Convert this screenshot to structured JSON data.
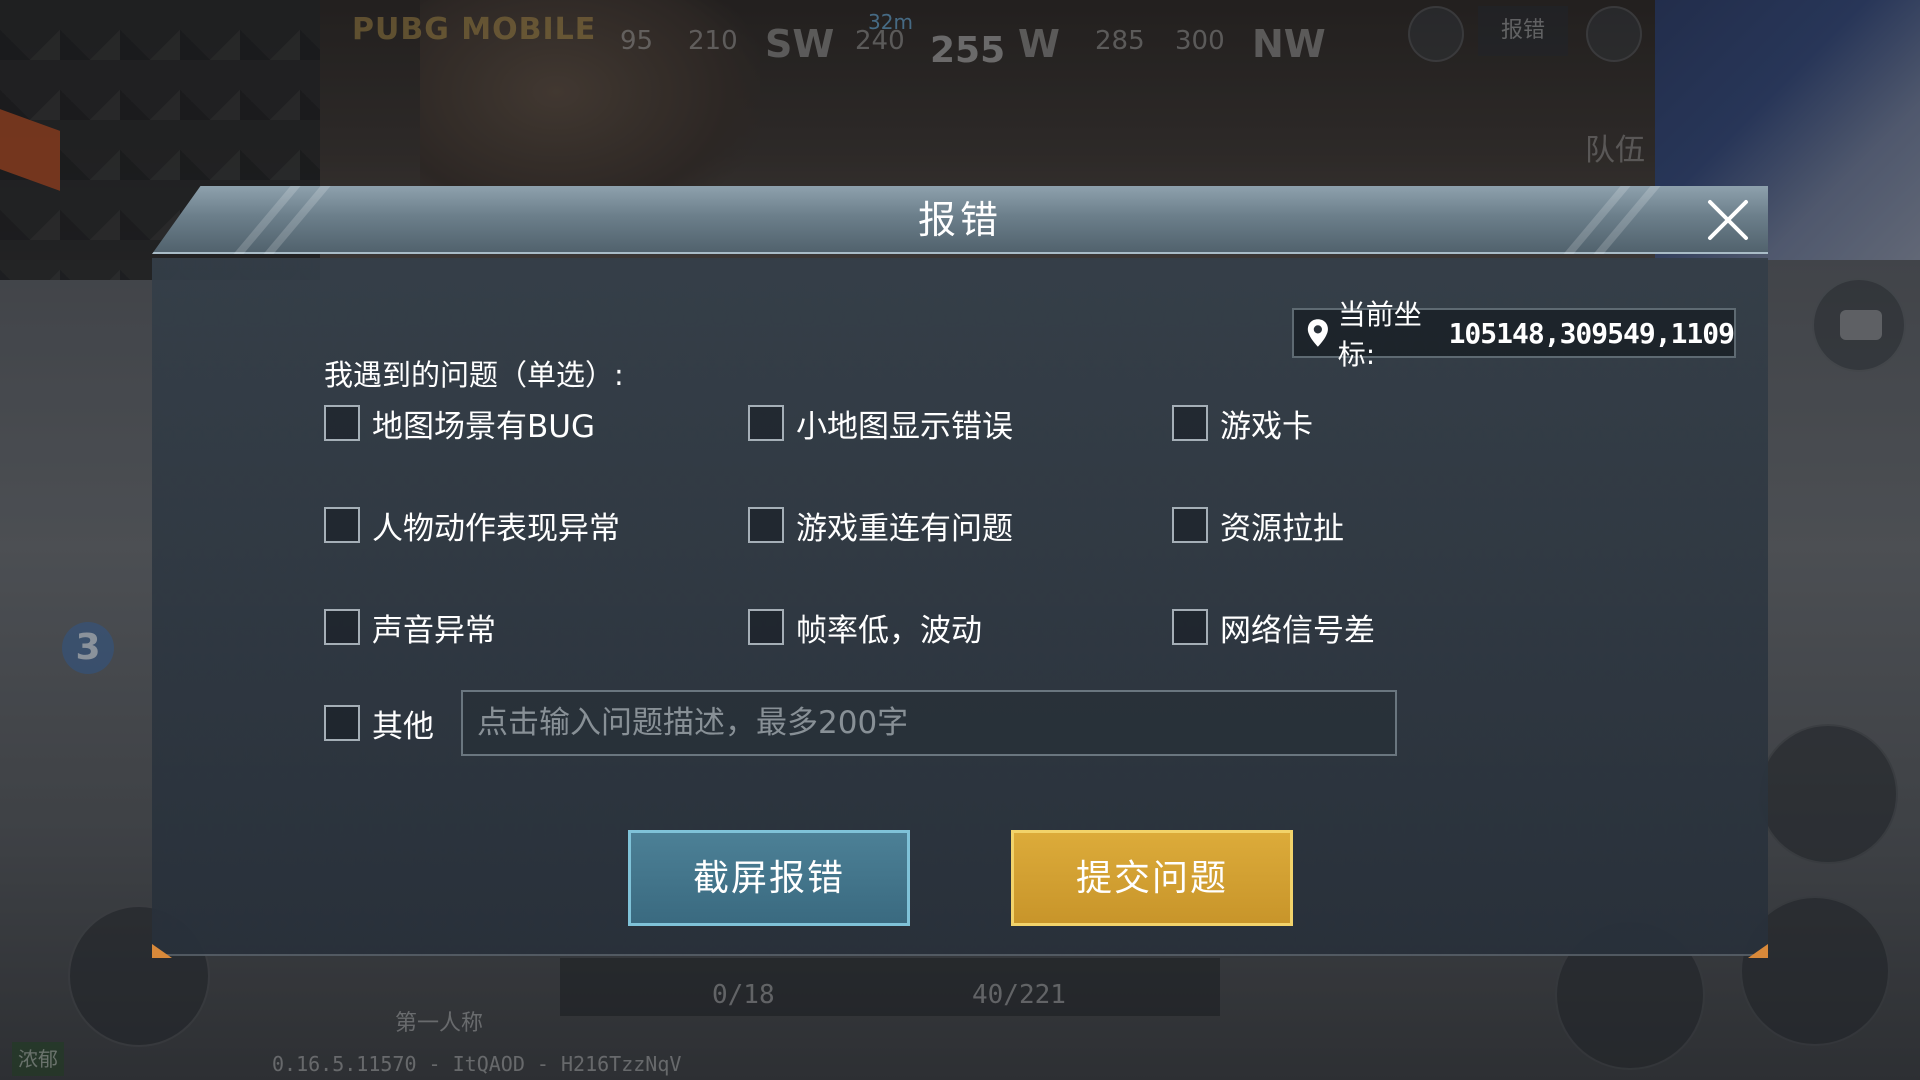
{
  "hud": {
    "logo": "PUBG MOBILE",
    "compass": {
      "ticks": [
        "95",
        "210",
        "SW",
        "240",
        "W",
        "285",
        "300",
        "NW"
      ],
      "heading": "255",
      "distance": "32m"
    },
    "report_chip": "报错",
    "team_label": "队伍",
    "left_badge": "3",
    "first_person": "第一人称",
    "ammo_primary": "0/18",
    "ammo_secondary": "40/221",
    "version": "0.16.5.11570 - ItQAOD - H216TzzNqV",
    "bottom_left_tag": "浓郁"
  },
  "dialog": {
    "title": "报错",
    "coords_label": "当前坐标:",
    "coords_value": "105148,309549,1109",
    "question": "我遇到的问题（单选）:",
    "options": [
      {
        "label": "地图场景有BUG"
      },
      {
        "label": "小地图显示错误"
      },
      {
        "label": "游戏卡"
      },
      {
        "label": "人物动作表现异常"
      },
      {
        "label": "游戏重连有问题"
      },
      {
        "label": "资源拉扯"
      },
      {
        "label": "声音异常"
      },
      {
        "label": "帧率低，波动"
      },
      {
        "label": "网络信号差"
      }
    ],
    "other_label": "其他",
    "other_placeholder": "点击输入问题描述，最多200字",
    "other_value": "",
    "screenshot_button": "截屏报错",
    "submit_button": "提交问题",
    "colors": {
      "submit": "#d6a332",
      "screenshot": "#437690",
      "accent_corner": "#d8893a"
    }
  }
}
